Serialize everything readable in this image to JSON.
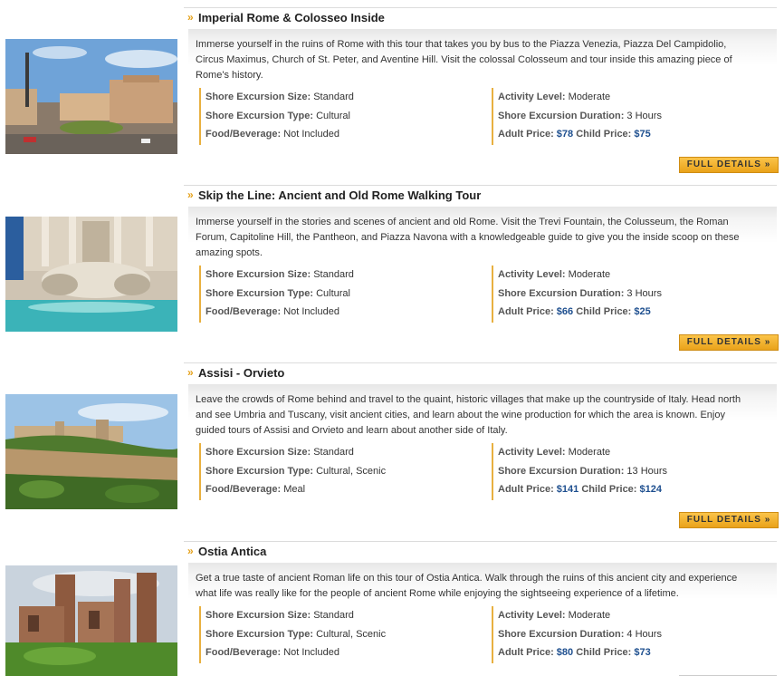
{
  "labels": {
    "size": "Shore Excursion Size:",
    "type": "Shore Excursion Type:",
    "food": "Food/Beverage:",
    "activity": "Activity Level:",
    "duration": "Shore Excursion Duration:",
    "adult": "Adult Price:",
    "child": "Child Price:",
    "button": "FULL DETAILS »",
    "chevron": "»"
  },
  "colors": {
    "accent": "#e5a21c",
    "price": "#1e4f8f",
    "button": "#f5b536"
  },
  "tours": [
    {
      "title": "Imperial Rome & Colosseo Inside",
      "description": "Immerse yourself in the ruins of Rome with this tour that takes you by bus to the Piazza Venezia, Piazza Del Campidolio, Circus Maximus, Church of St. Peter, and Aventine Hill. Visit the colossal Colosseum and tour inside this amazing piece of Rome's history.",
      "size": "Standard",
      "type": "Cultural",
      "food": "Not Included",
      "activity": "Moderate",
      "duration": "3 Hours",
      "adult_price": "$78",
      "child_price": "$75",
      "image": "piazza-venezia-photo"
    },
    {
      "title": "Skip the Line: Ancient and Old Rome Walking Tour",
      "description": "Immerse yourself in the stories and scenes of ancient and old Rome. Visit the Trevi Fountain, the Colusseum, the Roman Forum, Capitoline Hill, the Pantheon, and Piazza Navona with a knowledgeable guide to give you the inside scoop on these amazing spots.",
      "size": "Standard",
      "type": "Cultural",
      "food": "Not Included",
      "activity": "Moderate",
      "duration": "3 Hours",
      "adult_price": "$66",
      "child_price": "$25",
      "image": "trevi-fountain-photo"
    },
    {
      "title": "Assisi - Orvieto",
      "description": "Leave the crowds of Rome behind and travel to the quaint, historic villages that make up the countryside of Italy. Head north and see Umbria and Tuscany, visit ancient cities, and learn about the wine production for which the area is known. Enjoy guided tours of Assisi and Orvieto and learn about another side of Italy.",
      "size": "Standard",
      "type": "Cultural, Scenic",
      "food": "Meal",
      "activity": "Moderate",
      "duration": "13 Hours",
      "adult_price": "$141",
      "child_price": "$124",
      "image": "orvieto-hilltown-photo"
    },
    {
      "title": "Ostia Antica",
      "description": "Get a true taste of ancient Roman life on this tour of Ostia Antica. Walk through the ruins of this ancient city and experience what life was really like for the people of ancient Rome while enjoying the sightseeing experience of a lifetime.",
      "size": "Standard",
      "type": "Cultural, Scenic",
      "food": "Not Included",
      "activity": "Moderate",
      "duration": "4 Hours",
      "adult_price": "$80",
      "child_price": "$73",
      "image": "ostia-ruins-photo"
    }
  ]
}
